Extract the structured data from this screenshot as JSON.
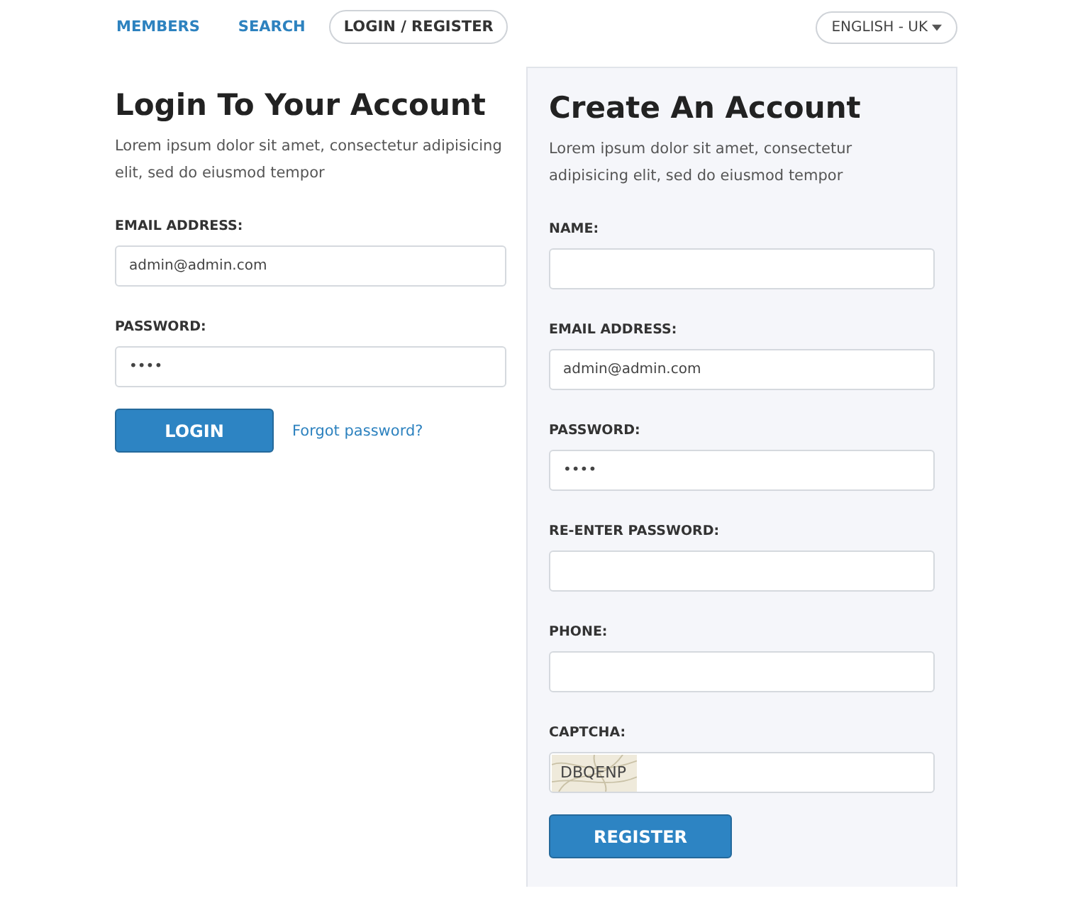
{
  "nav": {
    "items": [
      {
        "label": "MEMBERS",
        "selected": false
      },
      {
        "label": "SEARCH",
        "selected": false
      },
      {
        "label": "LOGIN / REGISTER",
        "selected": true
      }
    ],
    "language": "ENGLISH - UK"
  },
  "login": {
    "title": "Login To Your Account",
    "description": "Lorem ipsum dolor sit amet, consectetur adipisicing elit, sed do eiusmod tempor",
    "fields": [
      {
        "kind": "text",
        "label": "EMAIL ADDRESS:",
        "value": "admin@admin.com"
      },
      {
        "kind": "text",
        "label": "PASSWORD:",
        "value": "••••"
      }
    ],
    "button": "LOGIN",
    "link": "Forgot password?"
  },
  "register": {
    "title": "Create An Account",
    "description": "Lorem ipsum dolor sit amet, consectetur adipisicing elit, sed do eiusmod tempor",
    "fields": [
      {
        "kind": "text",
        "label": "NAME:"
      },
      {
        "kind": "text",
        "label": "EMAIL ADDRESS:",
        "value": "admin@admin.com"
      },
      {
        "kind": "text",
        "label": "PASSWORD:",
        "value": "••••"
      },
      {
        "kind": "text",
        "label": "RE-ENTER PASSWORD:"
      },
      {
        "kind": "text",
        "label": "PHONE:"
      },
      {
        "kind": "captcha",
        "label": "CAPTCHA:",
        "value": "DBQENP"
      }
    ],
    "button": "REGISTER"
  }
}
